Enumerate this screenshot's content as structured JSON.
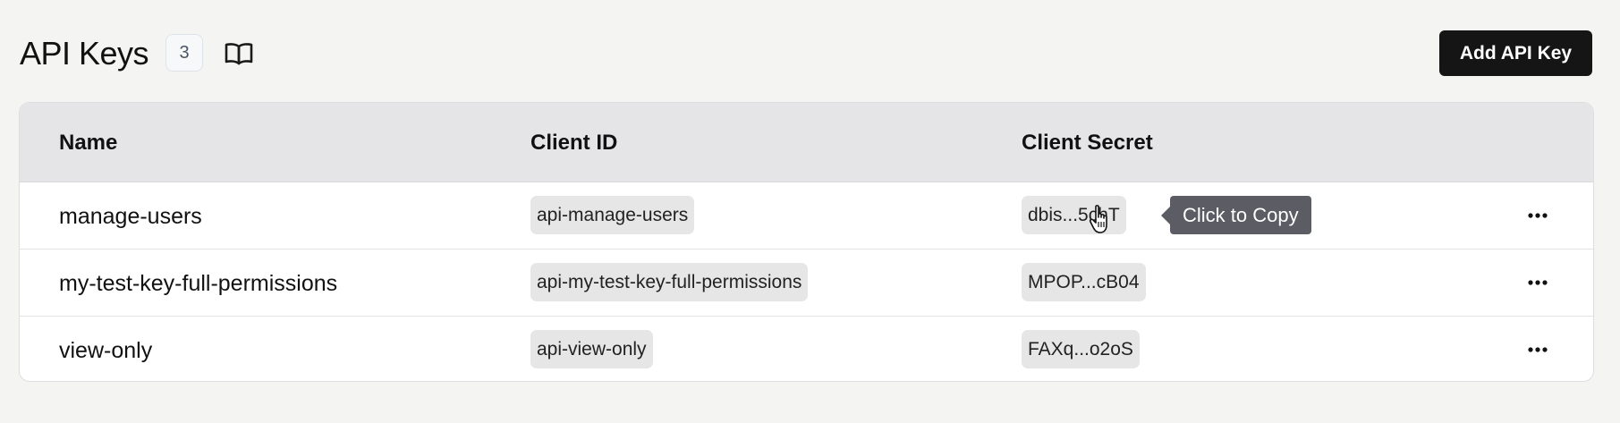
{
  "header": {
    "title": "API Keys",
    "count": "3",
    "docs_icon": "book-open-icon",
    "add_button_label": "Add API Key"
  },
  "table": {
    "columns": [
      "Name",
      "Client ID",
      "Client Secret"
    ],
    "rows": [
      {
        "name": "manage-users",
        "client_id": "api-manage-users",
        "client_secret": "dbis...5chT"
      },
      {
        "name": "my-test-key-full-permissions",
        "client_id": "api-my-test-key-full-permissions",
        "client_secret": "MPOP...cB04"
      },
      {
        "name": "view-only",
        "client_id": "api-view-only",
        "client_secret": "FAXq...o2oS"
      }
    ],
    "row_menu_icon": "more-horizontal-icon"
  },
  "tooltip": {
    "text": "Click to Copy"
  },
  "colors": {
    "page_bg": "#f4f4f3",
    "header_row_bg": "#e5e5e7",
    "primary_button": "#151515",
    "chip_bg": "#e6e6e6",
    "tooltip_bg": "#5b5c64"
  }
}
